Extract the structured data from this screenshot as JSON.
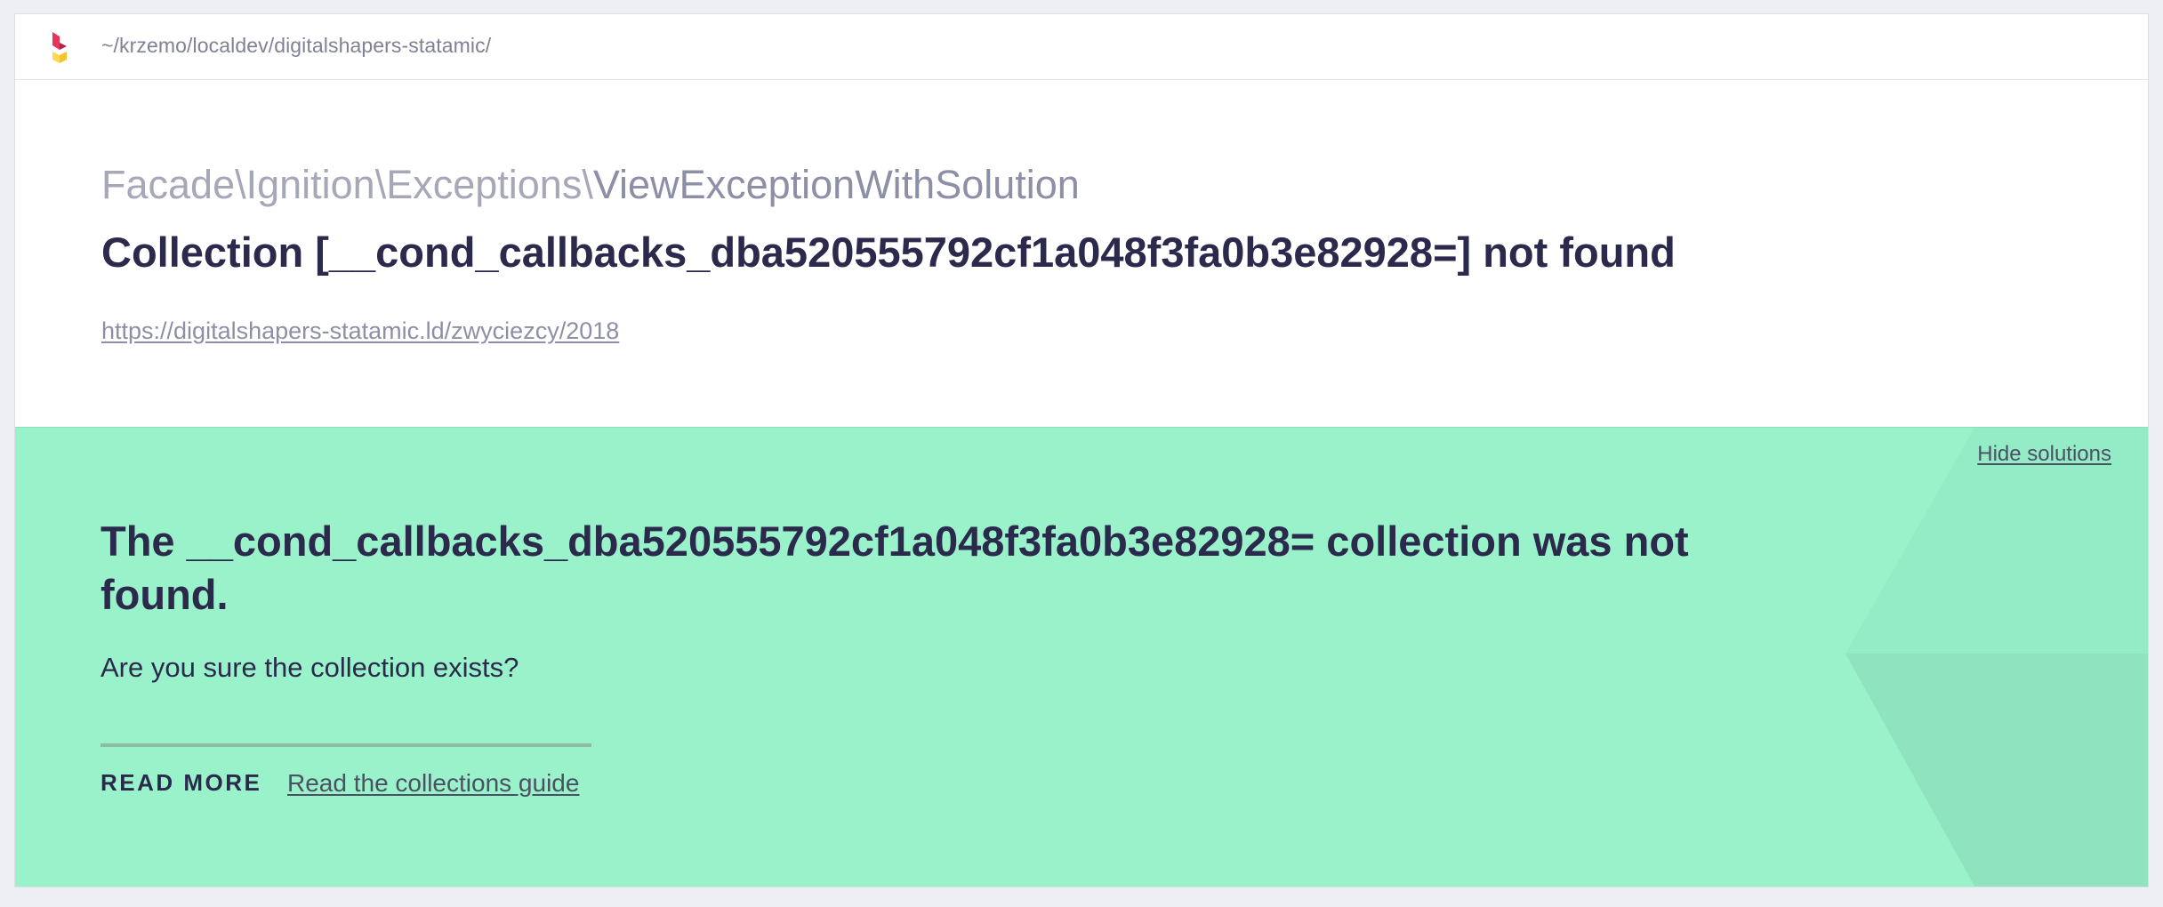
{
  "header": {
    "path": "~/krzemo/localdev/digitalshapers-statamic/"
  },
  "error": {
    "namespace": "Facade\\Ignition\\Exceptions\\",
    "class_name": "ViewExceptionWithSolution",
    "message": "Collection [__cond_callbacks_dba520555792cf1a048f3fa0b3e82928=] not found",
    "url": "https://digitalshapers-statamic.ld/zwyciezcy/2018"
  },
  "solution": {
    "hide_label": "Hide solutions",
    "title": "The __cond_callbacks_dba520555792cf1a048f3fa0b3e82928= collection was not found.",
    "description": "Are you sure the collection exists?",
    "read_more_label": "READ MORE",
    "link_label": "Read the collections guide"
  },
  "colors": {
    "background": "#eeeff5",
    "solution_bg": "#9af2cb",
    "text_dark": "#2b2a4c",
    "text_muted": "#8d8fa6",
    "logo_red": "#e8345a",
    "logo_yellow": "#ffd84d"
  },
  "icons": {
    "logo": "ignition-logo-icon",
    "decoration": "hexagon-decoration"
  }
}
